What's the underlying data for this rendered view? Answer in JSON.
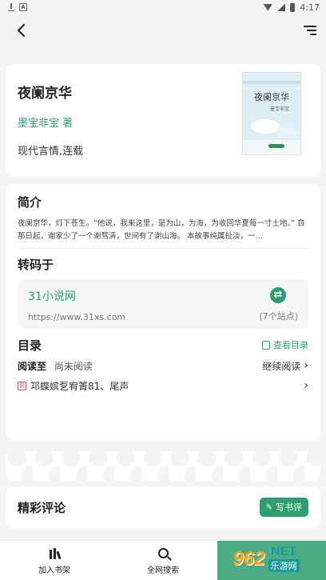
{
  "status_bar": {
    "time": "4:17"
  },
  "book": {
    "title": "夜阑京华",
    "author": "墨宝非宝 著",
    "tags": "现代言情,连载",
    "cover": {
      "title": "夜阑京华",
      "subtitle": "墨宝非宝"
    }
  },
  "intro": {
    "heading": "简介",
    "text": "夜阑京华，灯下苍生。“他说，我来这里，是为山，为海，为收回华夏每一寸土地。” 自那日起，谢家少了一个谢骛清，世间有了谢山海。 本故事纯属扯淡，一…"
  },
  "source": {
    "heading": "转码于",
    "site_name": "31小说网",
    "site_url": "https://www.31xs.com",
    "site_count": "(7个站点)"
  },
  "toc": {
    "heading": "目录",
    "view_label": "查看目录",
    "read_label": "阅读至",
    "read_value": "尚未阅读",
    "continue_label": "继续阅读",
    "chapter_icon_text": "前",
    "chapter": "邛蝶嫔乭宥箐81、尾声"
  },
  "reviews": {
    "heading": "精彩评论",
    "write_label": "写书评"
  },
  "bottom_nav": [
    {
      "label": "加入书架"
    },
    {
      "label": "全网搜索"
    }
  ],
  "watermark": {
    "logo": "962",
    "net": "NET",
    "cn": "乐游网"
  }
}
